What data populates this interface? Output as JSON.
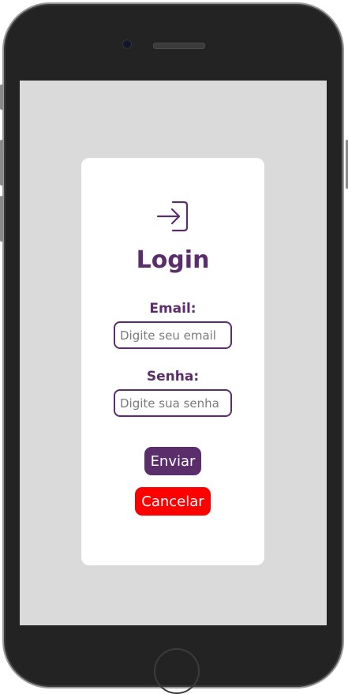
{
  "login": {
    "icon": "login-icon",
    "title": "Login",
    "email_label": "Email:",
    "email_placeholder": "Digite seu email",
    "password_label": "Senha:",
    "password_placeholder": "Digite sua senha",
    "submit_label": "Enviar",
    "cancel_label": "Cancelar"
  },
  "colors": {
    "accent": "#5a2d6b",
    "cancel": "#ff0000",
    "screen_background": "#dadada",
    "card_background": "#ffffff"
  }
}
